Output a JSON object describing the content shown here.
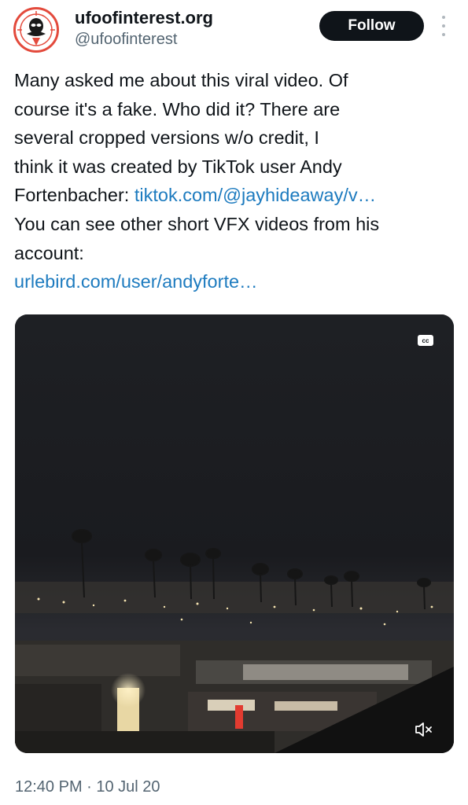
{
  "author": {
    "display_name": "ufoofinterest.org",
    "handle": "@ufoofinterest",
    "avatar_icon": "alien-logo-icon"
  },
  "actions": {
    "follow_label": "Follow",
    "more_icon": "more-vertical-icon"
  },
  "tweet": {
    "lines": [
      "Many asked me about this viral video. Of",
      "course it's a fake. Who did it? There are",
      "several cropped versions w/o credit, I",
      "think it was created by TikTok user Andy"
    ],
    "line5_text": "Fortenbacher: ",
    "link1": "tiktok.com/@jayhideaway/v…",
    "line6": "You can see other short VFX videos from his",
    "line7": "account:",
    "link2": "urlebird.com/user/andyforte…"
  },
  "media": {
    "cc_label": "cc",
    "mute_icon": "volume-muted-icon"
  },
  "footer": {
    "timestamp": "12:40 PM · 10 Jul 20"
  },
  "colors": {
    "link": "#1d7bbf",
    "follow_button": "#0f1419",
    "avatar_ring": "#e34a3c",
    "secondary_text": "#536471"
  }
}
